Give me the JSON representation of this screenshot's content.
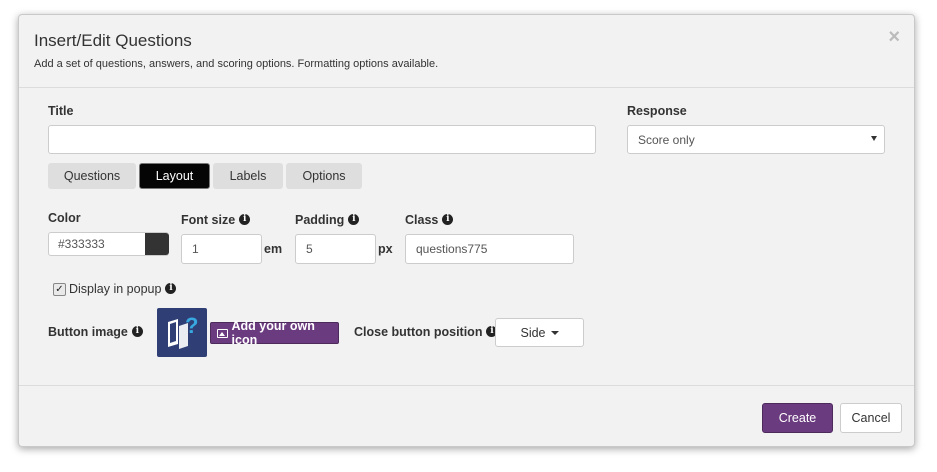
{
  "dialog": {
    "title": "Insert/Edit Questions",
    "subtitle": "Add a set of questions, answers, and scoring options. Formatting options available.",
    "close_glyph": "×"
  },
  "title_field": {
    "label": "Title",
    "value": ""
  },
  "response": {
    "label": "Response",
    "selected": "Score only"
  },
  "tabs": [
    {
      "label": "Questions",
      "active": false
    },
    {
      "label": "Layout",
      "active": true
    },
    {
      "label": "Labels",
      "active": false
    },
    {
      "label": "Options",
      "active": false
    }
  ],
  "layout": {
    "color_label": "Color",
    "color_value": "#333333",
    "font_size_label": "Font size",
    "font_size_value": "1",
    "font_size_unit": "em",
    "padding_label": "Padding",
    "padding_value": "5",
    "padding_unit": "px",
    "class_label": "Class",
    "class_value": "questions775",
    "display_popup_label": "Display in popup",
    "display_popup_checked": true,
    "button_image_label": "Button image",
    "add_icon_label": "Add your own icon",
    "close_position_label": "Close button position",
    "close_position_value": "Side"
  },
  "footer": {
    "create_label": "Create",
    "cancel_label": "Cancel"
  },
  "colors": {
    "accent": "#6b3b7f",
    "icon_bg": "#2f3f76",
    "icon_question": "#39a8e0"
  },
  "icons": {
    "info": "info-icon",
    "image": "image-icon",
    "question_book": "question-book-icon"
  }
}
